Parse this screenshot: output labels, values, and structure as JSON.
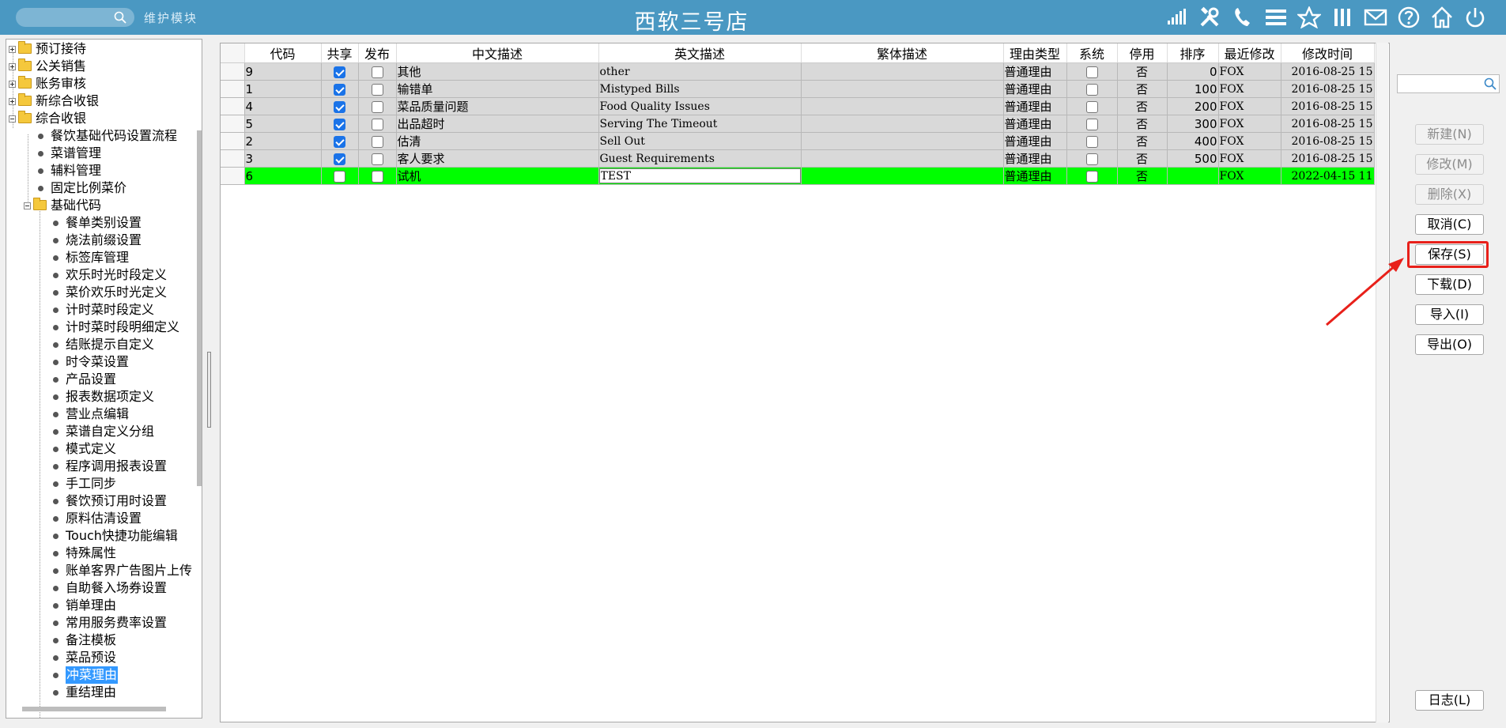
{
  "topbar": {
    "module_label": "维护模块",
    "title": "西软三号店",
    "icons": [
      "signal-icon",
      "tools-icon",
      "phone-icon",
      "menu-icon",
      "star-icon",
      "columns-icon",
      "mail-icon",
      "help-icon",
      "home-icon",
      "power-icon"
    ]
  },
  "tree": {
    "top_items": [
      {
        "label": "预订接待"
      },
      {
        "label": "公关销售"
      },
      {
        "label": "账务审核"
      },
      {
        "label": "新综合收银"
      },
      {
        "label": "综合收银"
      }
    ],
    "sub_items": [
      {
        "label": "餐饮基础代码设置流程"
      },
      {
        "label": "菜谱管理"
      },
      {
        "label": "辅料管理"
      },
      {
        "label": "固定比例菜价"
      }
    ],
    "folder_label": "基础代码",
    "leaf_items": [
      {
        "label": "餐单类别设置"
      },
      {
        "label": "烧法前缀设置"
      },
      {
        "label": "标签库管理"
      },
      {
        "label": "欢乐时光时段定义"
      },
      {
        "label": "菜价欢乐时光定义"
      },
      {
        "label": "计时菜时段定义"
      },
      {
        "label": "计时菜时段明细定义"
      },
      {
        "label": "结账提示自定义"
      },
      {
        "label": "时令菜设置"
      },
      {
        "label": "产品设置"
      },
      {
        "label": "报表数据项定义"
      },
      {
        "label": "营业点编辑"
      },
      {
        "label": "菜谱自定义分组"
      },
      {
        "label": "模式定义"
      },
      {
        "label": "程序调用报表设置"
      },
      {
        "label": "手工同步"
      },
      {
        "label": "餐饮预订用时设置"
      },
      {
        "label": "原料估清设置"
      },
      {
        "label": "Touch快捷功能编辑"
      },
      {
        "label": "特殊属性"
      },
      {
        "label": "账单客界广告图片上传"
      },
      {
        "label": "自助餐入场券设置"
      },
      {
        "label": "销单理由"
      },
      {
        "label": "常用服务费率设置"
      },
      {
        "label": "备注模板"
      },
      {
        "label": "菜品预设"
      },
      {
        "label": "冲菜理由"
      },
      {
        "label": "重结理由"
      }
    ],
    "selected": "冲菜理由"
  },
  "grid": {
    "columns": [
      "代码",
      "共享",
      "发布",
      "中文描述",
      "英文描述",
      "繁体描述",
      "理由类型",
      "系统",
      "停用",
      "排序",
      "最近修改",
      "修改时间"
    ],
    "rows": [
      {
        "code": "9",
        "share": true,
        "publish": false,
        "cn": "其他",
        "en": "other",
        "tw": "",
        "type": "普通理由",
        "sys": false,
        "disabled": "否",
        "order": "0",
        "modifier": "FOX",
        "time": "2016-08-25 15"
      },
      {
        "code": "1",
        "share": true,
        "publish": false,
        "cn": "输错单",
        "en": "Mistyped Bills",
        "tw": "",
        "type": "普通理由",
        "sys": false,
        "disabled": "否",
        "order": "100",
        "modifier": "FOX",
        "time": "2016-08-25 15"
      },
      {
        "code": "4",
        "share": true,
        "publish": false,
        "cn": "菜品质量问题",
        "en": "Food Quality Issues",
        "tw": "",
        "type": "普通理由",
        "sys": false,
        "disabled": "否",
        "order": "200",
        "modifier": "FOX",
        "time": "2016-08-25 15"
      },
      {
        "code": "5",
        "share": true,
        "publish": false,
        "cn": "出品超时",
        "en": "Serving The Timeout",
        "tw": "",
        "type": "普通理由",
        "sys": false,
        "disabled": "否",
        "order": "300",
        "modifier": "FOX",
        "time": "2016-08-25 15"
      },
      {
        "code": "2",
        "share": true,
        "publish": false,
        "cn": "估清",
        "en": "Sell Out",
        "tw": "",
        "type": "普通理由",
        "sys": false,
        "disabled": "否",
        "order": "400",
        "modifier": "FOX",
        "time": "2016-08-25 15"
      },
      {
        "code": "3",
        "share": true,
        "publish": false,
        "cn": "客人要求",
        "en": "Guest Requirements",
        "tw": "",
        "type": "普通理由",
        "sys": false,
        "disabled": "否",
        "order": "500",
        "modifier": "FOX",
        "time": "2016-08-25 15"
      }
    ],
    "editing_row": {
      "code": "6",
      "share": false,
      "publish": false,
      "cn": "试机",
      "en": "TEST",
      "tw": "",
      "type": "普通理由",
      "sys": false,
      "disabled": "否",
      "order": "",
      "modifier": "FOX",
      "time": "2022-04-15 11"
    }
  },
  "right_panel": {
    "buttons": {
      "new": "新建(N)",
      "edit": "修改(M)",
      "delete": "删除(X)",
      "cancel": "取消(C)",
      "save": "保存(S)",
      "download": "下载(D)",
      "import": "导入(I)",
      "export": "导出(O)",
      "log": "日志(L)"
    }
  },
  "colors": {
    "topbar": "#4a98c2",
    "editing_row": "#00ff00",
    "selected_tree": "#3399ff",
    "highlight": "#e8201a"
  }
}
